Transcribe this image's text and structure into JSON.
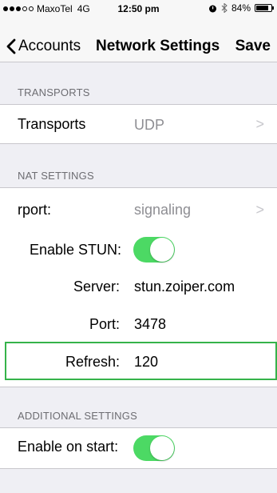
{
  "status": {
    "carrier": "MaxoTel",
    "network": "4G",
    "time": "12:50 pm",
    "battery": "84%",
    "battery_level": 0.84
  },
  "nav": {
    "back_label": "Accounts",
    "title": "Network Settings",
    "save_label": "Save"
  },
  "transports_section": {
    "header": "TRANSPORTS",
    "label": "Transports",
    "value": "UDP"
  },
  "nat_section": {
    "header": "NAT SETTINGS",
    "rport_label": "rport:",
    "rport_value": "signaling",
    "stun_label": "Enable STUN:",
    "stun_enabled": true,
    "server_label": "Server:",
    "server_value": "stun.zoiper.com",
    "port_label": "Port:",
    "port_value": "3478",
    "refresh_label": "Refresh:",
    "refresh_value": "120"
  },
  "additional_section": {
    "header": "ADDITIONAL SETTINGS",
    "enable_on_start_label": "Enable on start:",
    "enable_on_start": true
  },
  "colors": {
    "toggle_on": "#4cd964",
    "focus_border": "#35b34a",
    "background": "#efeff4"
  }
}
